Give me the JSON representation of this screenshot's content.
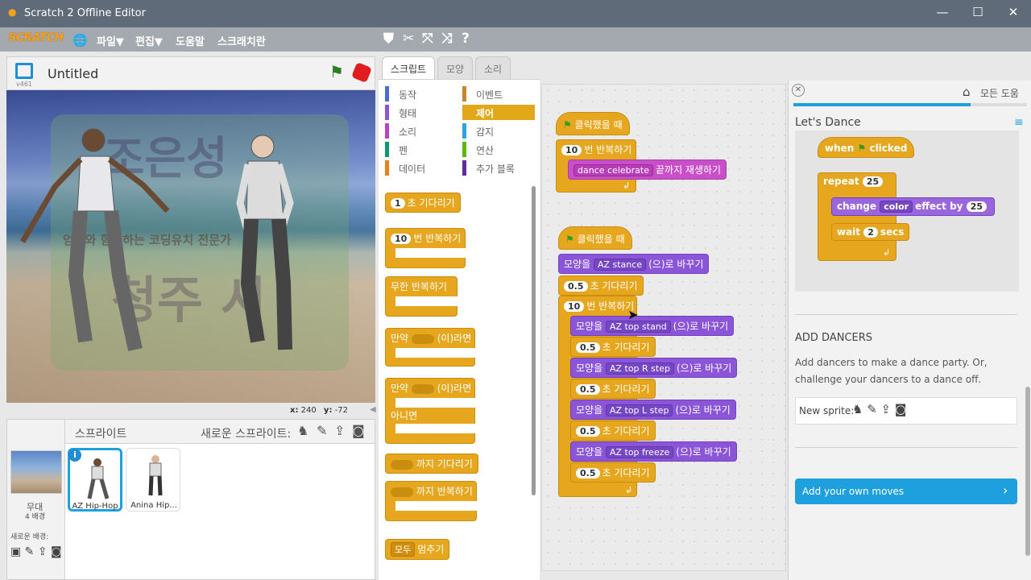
{
  "window": {
    "title": "Scratch 2 Offline Editor",
    "min": "—",
    "max": "☐",
    "close": "✕"
  },
  "menu": {
    "logo": "SCRATCH",
    "file": "파일▼",
    "edit": "편집▼",
    "tips": "도움말",
    "about": "스크래치란"
  },
  "stage": {
    "project_title": "Untitled",
    "version": "v461",
    "x_label": "x:",
    "x_value": "240",
    "y_label": "y:",
    "y_value": "-72",
    "watermark1": "조은성",
    "watermark2": "엄마와 함께하는 코딩유치 전문가",
    "watermark3": "청주 시"
  },
  "sprites": {
    "header": "스프라이트",
    "new_sprite": "새로운 스프라이트:",
    "stage_label": "무대",
    "stage_count": "4 배경",
    "new_backdrop": "새로운 배경:",
    "items": [
      {
        "name": "AZ Hip-Hop"
      },
      {
        "name": "Anina Hip..."
      }
    ]
  },
  "tabs": {
    "scripts": "스크립트",
    "costumes": "모양",
    "sounds": "소리"
  },
  "categories": [
    {
      "label": "동작",
      "color": "#4a6cd4"
    },
    {
      "label": "이벤트",
      "color": "#c88330"
    },
    {
      "label": "형태",
      "color": "#8a55d7"
    },
    {
      "label": "제어",
      "color": "#e1a91a"
    },
    {
      "label": "소리",
      "color": "#bb42c3"
    },
    {
      "label": "감지",
      "color": "#2ca5e2"
    },
    {
      "label": "펜",
      "color": "#0e9a6c"
    },
    {
      "label": "연산",
      "color": "#5cb712"
    },
    {
      "label": "데이터",
      "color": "#ee7d16"
    },
    {
      "label": "추가 블록",
      "color": "#632d99"
    }
  ],
  "palette": {
    "wait_num": "1",
    "wait": "초 기다리기",
    "repeat_num": "10",
    "repeat": "번 반복하기",
    "forever": "무한 반복하기",
    "if_pre": "만약",
    "if_post": "(이)라면",
    "else": "아니면",
    "wait_until": "까지 기다리기",
    "repeat_until": "까지 반복하기",
    "stop_dd": "모두",
    "stop": "멈추기"
  },
  "scripts": {
    "s1": {
      "hat": "클릭했을 때",
      "repeat_num": "10",
      "repeat": "번 반복하기",
      "sound": "dance celebrate",
      "sound_post": "끝까지 재생하기"
    },
    "s2": {
      "hat": "클릭했을 때",
      "switch_pre": "모양을",
      "c0": "AZ stance",
      "switch_post": "(으)로 바꾸기",
      "wait_num": "0.5",
      "wait": "초 기다리기",
      "repeat_num": "10",
      "repeat": "번 반복하기",
      "c1": "AZ top stand",
      "c2": "AZ top R step",
      "c3": "AZ top L step",
      "c4": "AZ top freeze"
    }
  },
  "help": {
    "home": "모든 도움",
    "title": "Let's Dance",
    "when": "when",
    "clicked": "clicked",
    "repeat": "repeat",
    "repeat_num": "25",
    "change": "change",
    "color": "color",
    "effect_by": "effect by",
    "effect_num": "25",
    "wait": "wait",
    "wait_num": "2",
    "secs": "secs",
    "section": "ADD DANCERS",
    "desc": "Add dancers to make a dance party. Or, challenge your dancers to a dance off.",
    "new_sprite": "New sprite:",
    "next": "Add your own moves",
    "next_arrow": "›"
  }
}
